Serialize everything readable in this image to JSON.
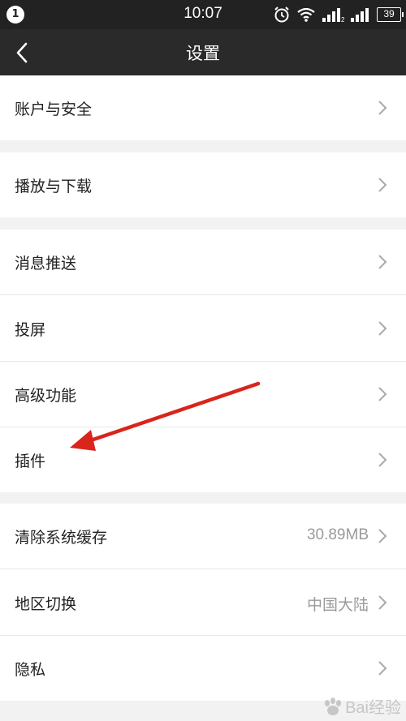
{
  "status": {
    "badge": "1",
    "time": "10:07",
    "battery": "39",
    "sim_label": "2"
  },
  "nav": {
    "title": "设置"
  },
  "rows": [
    {
      "label": "账户与安全",
      "value": ""
    },
    {
      "label": "播放与下载",
      "value": ""
    },
    {
      "label": "消息推送",
      "value": ""
    },
    {
      "label": "投屏",
      "value": ""
    },
    {
      "label": "高级功能",
      "value": ""
    },
    {
      "label": "插件",
      "value": ""
    },
    {
      "label": "清除系统缓存",
      "value": "30.89MB"
    },
    {
      "label": "地区切换",
      "value": "中国大陆"
    },
    {
      "label": "隐私",
      "value": ""
    }
  ],
  "watermark": {
    "text": "Bai经验"
  },
  "colors": {
    "status_bar": "#222222",
    "nav_bar": "#2a2a2a",
    "annotation_arrow": "#d9251c",
    "chevron": "#aaaaaa"
  },
  "icons": [
    "back-icon",
    "alarm-icon",
    "wifi-icon",
    "signal-icon",
    "battery-icon",
    "chevron-right-icon"
  ]
}
